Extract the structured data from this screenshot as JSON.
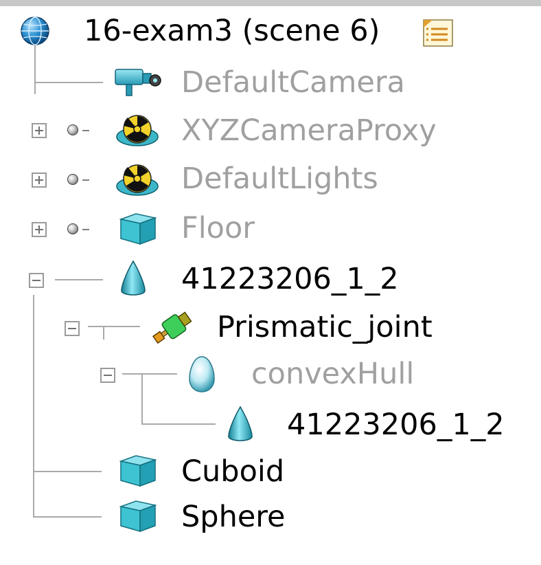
{
  "scene_tree": {
    "root": {
      "label": "16-exam3 (scene 6)",
      "icon": "globe-icon",
      "trailing_icon": "notes-icon"
    },
    "items": [
      {
        "label": "DefaultCamera",
        "icon": "camera-icon",
        "dimmed": true
      },
      {
        "label": "XYZCameraProxy",
        "icon": "radiation-node-icon",
        "dimmed": true,
        "expander": "collapsed"
      },
      {
        "label": "DefaultLights",
        "icon": "radiation-node-icon",
        "dimmed": true,
        "expander": "collapsed"
      },
      {
        "label": "Floor",
        "icon": "cube-icon",
        "dimmed": true,
        "expander": "collapsed"
      },
      {
        "label": "41223206_1_2",
        "icon": "cone-icon",
        "dimmed": false,
        "expander": "expanded"
      },
      {
        "label": "Prismatic_joint",
        "icon": "joint-icon",
        "dimmed": false,
        "expander": "expanded"
      },
      {
        "label": "convexHull",
        "icon": "egg-icon",
        "dimmed": true,
        "expander": "expanded"
      },
      {
        "label": "41223206_1_2",
        "icon": "cone-icon",
        "dimmed": false
      },
      {
        "label": "Cuboid",
        "icon": "cube-icon",
        "dimmed": false
      },
      {
        "label": "Sphere",
        "icon": "cube-icon",
        "dimmed": false
      }
    ]
  },
  "colors": {
    "header_bar": "#c8c8c8",
    "connector": "#a9a9a9",
    "dimmed_text": "#a0a0a0",
    "text": "#000000"
  }
}
